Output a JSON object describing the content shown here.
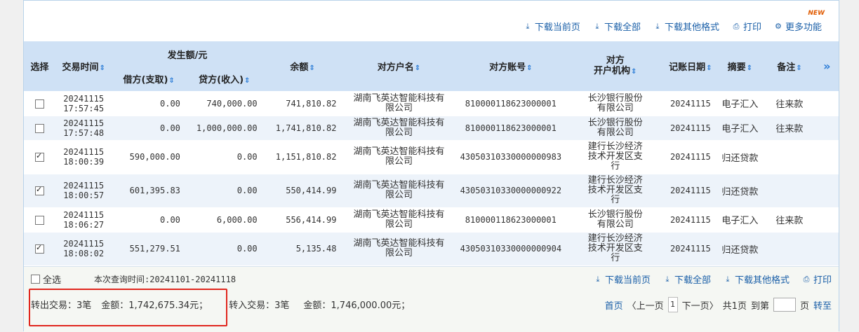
{
  "toolbar": {
    "download_page": "下载当前页",
    "download_all": "下载全部",
    "download_other": "下载其他格式",
    "print": "打印",
    "more": "更多功能",
    "new_badge": "NEW"
  },
  "table": {
    "headers": {
      "select": "选择",
      "time": "交易时间",
      "amount_group": "发生额/元",
      "debit": "借方(支取)",
      "credit": "贷方(收入)",
      "balance": "余额",
      "counterparty_name": "对方户名",
      "counterparty_account": "对方账号",
      "counterparty_bank_1": "对方",
      "counterparty_bank_2": "开户机构",
      "post_date": "记账日期",
      "summary": "摘要",
      "remark": "备注",
      "more_cols": "»"
    },
    "rows": [
      {
        "checked": false,
        "date": "20241115",
        "time": "17:57:45",
        "debit": "0.00",
        "credit": "740,000.00",
        "balance": "741,810.82",
        "name_1": "湖南飞英达智能科技有",
        "name_2": "限公司",
        "account": "810000118623000001",
        "bank_1": "长沙银行股份",
        "bank_2": "有限公司",
        "bank_3": "",
        "post_date": "20241115",
        "summary": "电子汇入",
        "remark": "往来款"
      },
      {
        "checked": false,
        "date": "20241115",
        "time": "17:57:48",
        "debit": "0.00",
        "credit": "1,000,000.00",
        "balance": "1,741,810.82",
        "name_1": "湖南飞英达智能科技有",
        "name_2": "限公司",
        "account": "810000118623000001",
        "bank_1": "长沙银行股份",
        "bank_2": "有限公司",
        "bank_3": "",
        "post_date": "20241115",
        "summary": "电子汇入",
        "remark": "往来款"
      },
      {
        "checked": true,
        "date": "20241115",
        "time": "18:00:39",
        "debit": "590,000.00",
        "credit": "0.00",
        "balance": "1,151,810.82",
        "name_1": "湖南飞英达智能科技有",
        "name_2": "限公司",
        "account": "43050310330000000983",
        "bank_1": "建行长沙经济",
        "bank_2": "技术开发区支",
        "bank_3": "行",
        "post_date": "20241115",
        "summary": "归还贷款",
        "remark": ""
      },
      {
        "checked": true,
        "date": "20241115",
        "time": "18:00:57",
        "debit": "601,395.83",
        "credit": "0.00",
        "balance": "550,414.99",
        "name_1": "湖南飞英达智能科技有",
        "name_2": "限公司",
        "account": "43050310330000000922",
        "bank_1": "建行长沙经济",
        "bank_2": "技术开发区支",
        "bank_3": "行",
        "post_date": "20241115",
        "summary": "归还贷款",
        "remark": ""
      },
      {
        "checked": false,
        "date": "20241115",
        "time": "18:06:27",
        "debit": "0.00",
        "credit": "6,000.00",
        "balance": "556,414.99",
        "name_1": "湖南飞英达智能科技有",
        "name_2": "限公司",
        "account": "810000118623000001",
        "bank_1": "长沙银行股份",
        "bank_2": "有限公司",
        "bank_3": "",
        "post_date": "20241115",
        "summary": "电子汇入",
        "remark": "往来款"
      },
      {
        "checked": true,
        "date": "20241115",
        "time": "18:08:02",
        "debit": "551,279.51",
        "credit": "0.00",
        "balance": "5,135.48",
        "name_1": "湖南飞英达智能科技有",
        "name_2": "限公司",
        "account": "43050310330000000904",
        "bank_1": "建行长沙经济",
        "bank_2": "技术开发区支",
        "bank_3": "行",
        "post_date": "20241115",
        "summary": "归还贷款",
        "remark": ""
      }
    ]
  },
  "footer": {
    "select_all": "全选",
    "query_time": "本次查询时间:20241101-20241118",
    "download_page": "下载当前页",
    "download_all": "下载全部",
    "download_other": "下载其他格式",
    "print": "打印",
    "out_label": "转出交易：3笔",
    "out_amount": "金额：1,742,675.34元；",
    "in_label": "转入交易：3笔",
    "in_amount": "金额：1,746,000.00元；"
  },
  "pager": {
    "first": "首页",
    "prev": "〈上一页",
    "current": "1",
    "next": "下一页〉",
    "total": "共1页",
    "goto_prefix": "到第",
    "goto_suffix": "页",
    "go": "转至"
  },
  "colors": {
    "accent": "#1a5fa8",
    "header_bg": "#cfe1f5",
    "highlight": "#e0261d"
  }
}
